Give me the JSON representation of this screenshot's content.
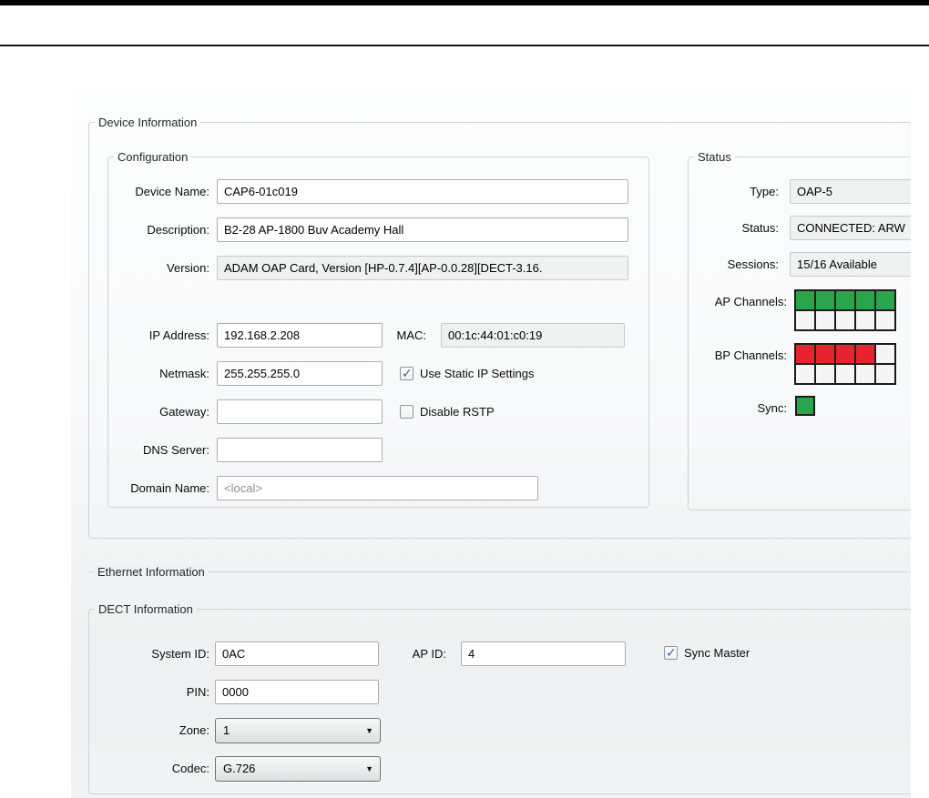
{
  "icons": {
    "dropdown_arrow": "▼",
    "checkmark": "✓"
  },
  "colors": {
    "channel_green": "#29a64b",
    "channel_red": "#e62430",
    "check_blue": "#3a5fb0"
  },
  "device_information": {
    "title": "Device Information",
    "configuration": {
      "title": "Configuration",
      "device_name": {
        "label": "Device Name:",
        "value": "CAP6-01c019"
      },
      "description": {
        "label": "Description:",
        "value": "B2-28 AP-1800 Buv Academy Hall"
      },
      "version": {
        "label": "Version:",
        "value": "ADAM OAP Card, Version [HP-0.7.4][AP-0.0.28][DECT-3.16."
      },
      "ip_address": {
        "label": "IP Address:",
        "value": "192.168.2.208"
      },
      "mac": {
        "label": "MAC:",
        "value": "00:1c:44:01:c0:19"
      },
      "netmask": {
        "label": "Netmask:",
        "value": "255.255.255.0"
      },
      "use_static_ip": {
        "label": "Use Static IP Settings",
        "checked": "true"
      },
      "gateway": {
        "label": "Gateway:",
        "value": ""
      },
      "disable_rstp": {
        "label": "Disable RSTP",
        "checked": "false"
      },
      "dns_server": {
        "label": "DNS Server:",
        "value": ""
      },
      "domain_name": {
        "label": "Domain Name:",
        "value": "<local>"
      }
    },
    "status": {
      "title": "Status",
      "type": {
        "label": "Type:",
        "value": "OAP-5"
      },
      "status": {
        "label": "Status:",
        "value": "CONNECTED: ARW"
      },
      "sessions": {
        "label": "Sessions:",
        "value": "15/16 Available"
      },
      "ap_channels": {
        "label": "AP Channels:",
        "cells": [
          "green",
          "green",
          "green",
          "green",
          "green",
          "white",
          "white",
          "white",
          "white",
          "white"
        ]
      },
      "bp_channels": {
        "label": "BP Channels:",
        "cells": [
          "red",
          "red",
          "red",
          "red",
          "white",
          "white",
          "white",
          "white",
          "white",
          "white"
        ]
      },
      "sync": {
        "label": "Sync:",
        "state": "green"
      }
    }
  },
  "ethernet_information": {
    "title": "Ethernet Information"
  },
  "dect_information": {
    "title": "DECT Information",
    "system_id": {
      "label": "System ID:",
      "value": "0AC"
    },
    "ap_id": {
      "label": "AP ID:",
      "value": "4"
    },
    "sync_master": {
      "label": "Sync Master",
      "checked": "true"
    },
    "pin": {
      "label": "PIN:",
      "value": "0000"
    },
    "zone": {
      "label": "Zone:",
      "value": "1"
    },
    "codec": {
      "label": "Codec:",
      "value": "G.726"
    }
  }
}
